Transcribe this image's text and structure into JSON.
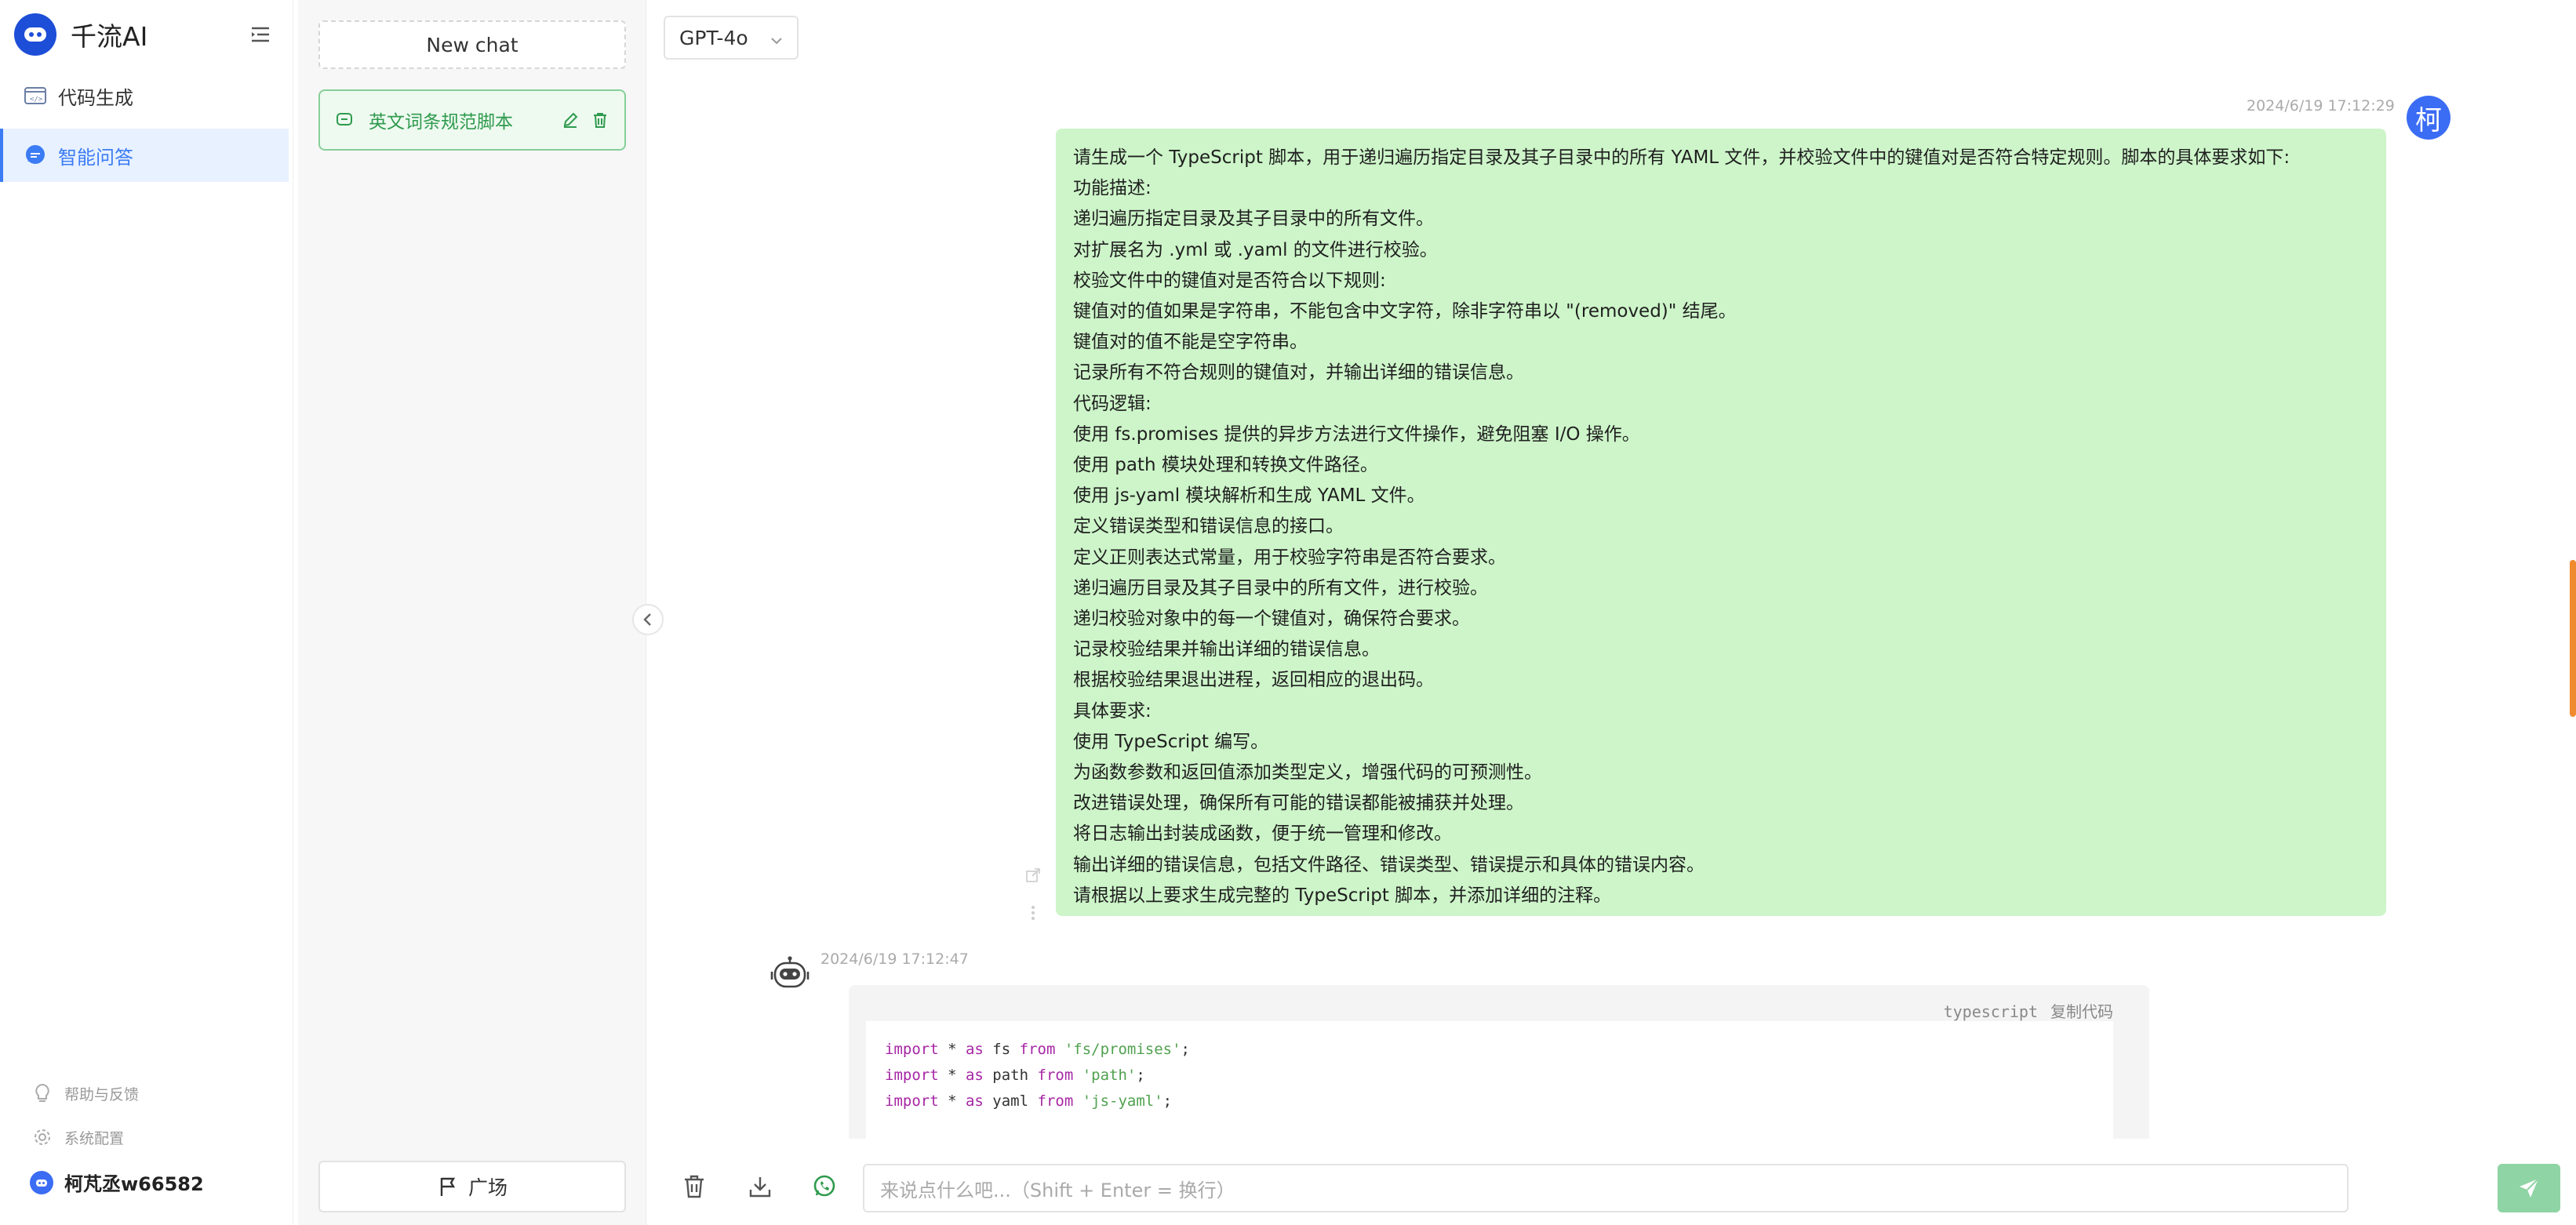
{
  "app": {
    "title": "千流AI"
  },
  "nav": {
    "items": [
      {
        "label": "代码生成",
        "icon": "code-icon",
        "active": false
      },
      {
        "label": "智能问答",
        "icon": "chat-bubble-icon",
        "active": true
      }
    ],
    "footer": {
      "help_label": "帮助与反馈",
      "settings_label": "系统配置"
    },
    "user_name": "柯芃丞w66582"
  },
  "conversations": {
    "new_chat_label": "New chat",
    "items": [
      {
        "label": "英文词条规范脚本",
        "selected": true
      }
    ],
    "plaza_label": "广场"
  },
  "main": {
    "model": "GPT-4o",
    "user_message": {
      "timestamp": "2024/6/19 17:12:29",
      "avatar_text": "柯",
      "lines": [
        "请生成一个 TypeScript 脚本，用于递归遍历指定目录及其子目录中的所有 YAML 文件，并校验文件中的键值对是否符合特定规则。脚本的具体要求如下:",
        "功能描述:",
        "递归遍历指定目录及其子目录中的所有文件。",
        "对扩展名为 .yml 或 .yaml 的文件进行校验。",
        "校验文件中的键值对是否符合以下规则:",
        "键值对的值如果是字符串，不能包含中文字符，除非字符串以 \"(removed)\" 结尾。",
        "键值对的值不能是空字符串。",
        "记录所有不符合规则的键值对，并输出详细的错误信息。",
        "代码逻辑:",
        "使用 fs.promises 提供的异步方法进行文件操作，避免阻塞 I/O 操作。",
        "使用 path 模块处理和转换文件路径。",
        "使用 js-yaml 模块解析和生成 YAML 文件。",
        "定义错误类型和错误信息的接口。",
        "定义正则表达式常量，用于校验字符串是否符合要求。",
        "递归遍历目录及其子目录中的所有文件，进行校验。",
        "递归校验对象中的每一个键值对，确保符合要求。",
        "记录校验结果并输出详细的错误信息。",
        "根据校验结果退出进程，返回相应的退出码。",
        "具体要求:",
        "使用 TypeScript 编写。",
        "为函数参数和返回值添加类型定义，增强代码的可预测性。",
        "改进错误处理，确保所有可能的错误都能被捕获并处理。",
        "将日志输出封装成函数，便于统一管理和修改。",
        "输出详细的错误信息，包括文件路径、错误类型、错误提示和具体的错误内容。",
        "请根据以上要求生成完整的 TypeScript 脚本，并添加详细的注释。"
      ]
    },
    "bot_message": {
      "timestamp": "2024/6/19 17:12:47",
      "code_lang": "typescript",
      "copy_label": "复制代码",
      "code_lines": [
        {
          "kw1": "import",
          "mid": " * ",
          "kw2": "as",
          "name": " fs ",
          "kw3": "from",
          "str": " 'fs/promises'",
          "end": ";"
        },
        {
          "kw1": "import",
          "mid": " * ",
          "kw2": "as",
          "name": " path ",
          "kw3": "from",
          "str": " 'path'",
          "end": ";"
        },
        {
          "kw1": "import",
          "mid": " * ",
          "kw2": "as",
          "name": " yaml ",
          "kw3": "from",
          "str": " 'js-yaml'",
          "end": ";"
        }
      ]
    },
    "input_placeholder": "来说点什么吧...（Shift + Enter = 换行）"
  },
  "colors": {
    "accent_blue": "#3b7cf4",
    "bubble_green": "#cdf5c9",
    "selected_conv_border": "#86cf98",
    "send_button": "#8fd4a4"
  }
}
